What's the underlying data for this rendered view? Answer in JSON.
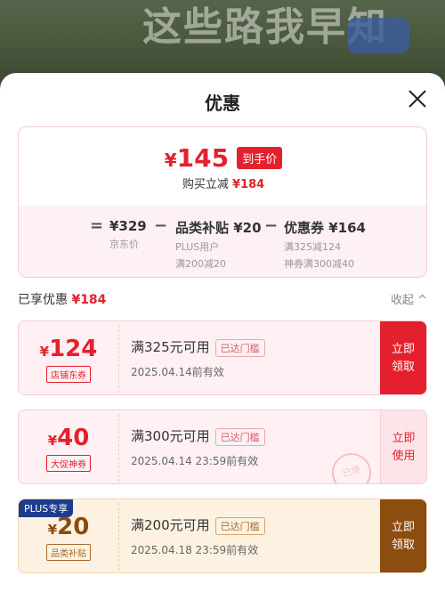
{
  "background": {
    "title": "这些路我早知"
  },
  "sheet": {
    "title": "优惠"
  },
  "summary": {
    "yen": "¥",
    "price": "145",
    "price_tag": "到手价",
    "reduce_label": "购买立减",
    "reduce_amount": "¥184",
    "base_label": "京东价",
    "base_value": "¥329",
    "subsidy_value": "品类补贴 ¥20",
    "subsidy_sub1": "PLUS用户",
    "subsidy_sub2": "满200减20",
    "coupon_value": "优惠券 ¥164",
    "coupon_sub1": "满325减124",
    "coupon_sub2": "神券满300减40",
    "op_eq": "=",
    "op_minus1": "−",
    "op_minus2": "−"
  },
  "enjoyed": {
    "label": "已享优惠",
    "amount": "¥184",
    "collapse": "收起 ^"
  },
  "coupons": [
    {
      "yen": "¥",
      "amount": "124",
      "tag": "店铺东券",
      "condition": "满325元可用",
      "badge": "已达门槛",
      "expiry": "2025.04.14前有效",
      "button": "立即领取"
    },
    {
      "yen": "¥",
      "amount": "40",
      "tag": "大促神券",
      "condition": "满300元可用",
      "badge": "已达门槛",
      "expiry": "2025.04.14 23:59前有效",
      "button": "立即使用",
      "stamp": "已领"
    },
    {
      "plus": "PLUS专享",
      "yen": "¥",
      "amount": "20",
      "tag": "品类补贴",
      "condition": "满200元可用",
      "badge": "已达门槛",
      "expiry": "2025.04.18 23:59前有效",
      "button": "立即领取"
    }
  ],
  "colors": {
    "accent": "#e4202e",
    "plus": "#1e3c8c",
    "gold": "#8b4d10"
  }
}
